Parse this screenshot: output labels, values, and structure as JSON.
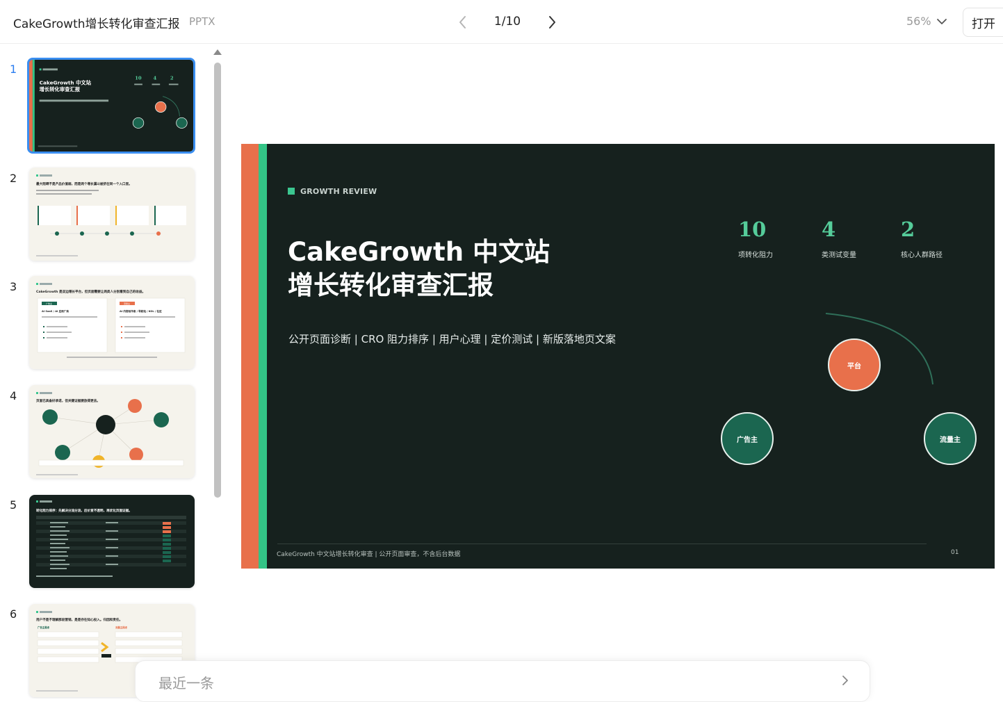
{
  "header": {
    "title": "CakeGrowth增长转化审查汇报",
    "file_type": "PPTX",
    "page_indicator": "1/10",
    "zoom": "56%",
    "open_label": "打开"
  },
  "thumbnails": {
    "numbers": [
      "1",
      "2",
      "3",
      "4",
      "5",
      "6"
    ],
    "t2_title": "最大阻碍不是产品价值弱，而是两个增长漏斗被挤在同一个入口里。",
    "t3_title": "CakeGrowth 是双边增长平台，但页面需要让两类人分别看到自己的收益。",
    "t3_tag_left": "广告主",
    "t3_tag_right": "流量主",
    "t3_item_left": "AI SaaS / AI 应用厂商",
    "t3_item_right": "AI 内容创作者 / 导航站 / KOL / 社区",
    "t4_title": "页面已具备好承诺，但关键证据要放得更去。",
    "t5_title": "转化阻力排序：先解决分流分流，后价宣不透明，再优化页面证据。",
    "t6_title": "用户不是不理解那段营销，是是存在知心投入。归因和责任。",
    "t6_col_left": "广告主要虑",
    "t6_col_right": "流量主顾虑"
  },
  "slide": {
    "kicker": "GROWTH REVIEW",
    "title_line1": "CakeGrowth 中文站",
    "title_line2": "增长转化审查汇报",
    "subtitle": "公开页面诊断 | CRO 阻力排序 | 用户心理 | 定价测试 | 新版落地页文案",
    "stats": [
      {
        "value": "10",
        "label": "项转化阻力"
      },
      {
        "value": "4",
        "label": "类测试变量"
      },
      {
        "value": "2",
        "label": "核心人群路径"
      }
    ],
    "nodes": {
      "platform": "平台",
      "advertiser": "广告主",
      "publisher": "流量主"
    },
    "footer": "CakeGrowth 中文站增长转化审查 | 公开页面审查，不含后台数据",
    "page": "01"
  },
  "recent": {
    "label": "最近一条"
  },
  "colors": {
    "slide_bg": "#16211e",
    "accent_orange": "#e8704b",
    "accent_green": "#33c486",
    "node_green": "#1b6650",
    "active_blue": "#3a8ef0"
  }
}
